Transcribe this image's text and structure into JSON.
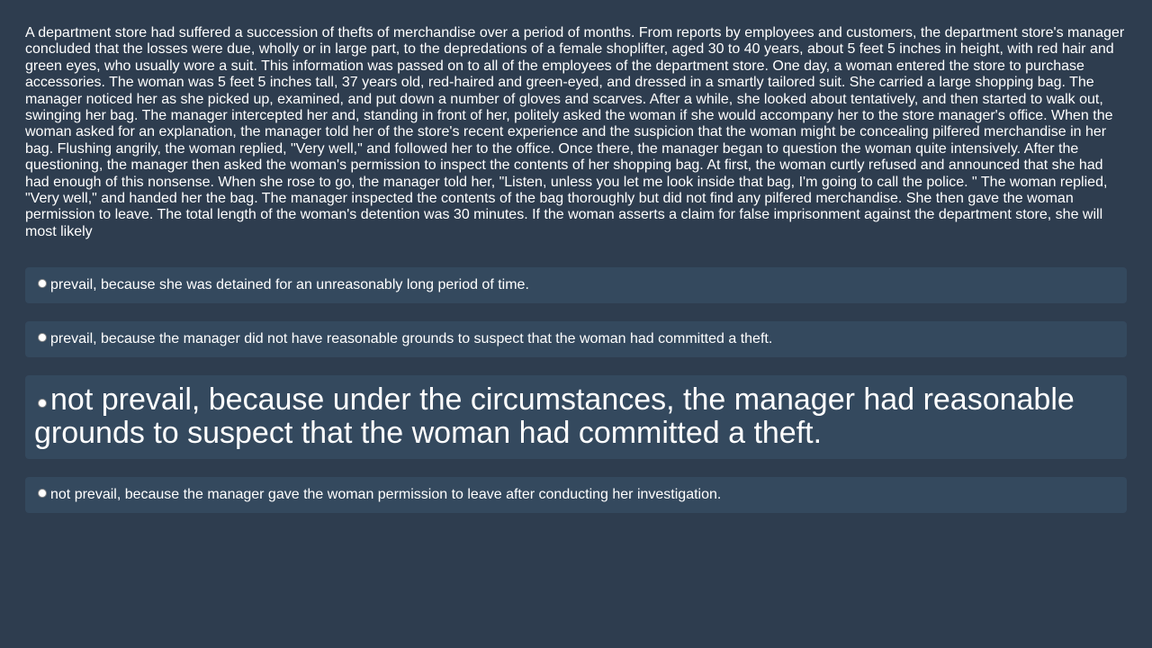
{
  "question": "A department store had suffered a succession of thefts of merchandise over a period of months. From reports by employees and customers, the department store's manager concluded that the losses were due, wholly or in large part, to the depredations of a female shoplifter, aged 30 to 40 years, about 5 feet 5 inches in height, with red hair and green eyes, who usually wore a suit. This information was passed on to all of the employees of the department store. One day, a woman entered the store to purchase accessories. The woman was 5 feet 5 inches tall, 37 years old, red-haired and green-eyed, and dressed in a smartly tailored suit. She carried a large shopping bag. The manager noticed her as she picked up, examined, and put down a number of gloves and scarves. After a while, she looked about tentatively, and then started to walk out, swinging her bag. The manager intercepted her and, standing in front of her, politely asked the woman if she would accompany her to the store manager's office. When the woman asked for an explanation, the manager told her of the store's recent experience and the suspicion that the woman might be concealing pilfered merchandise in her bag. Flushing angrily, the woman replied, \"Very well,\" and followed her to the office. Once there, the manager began to question the woman quite intensively. After the questioning, the manager then asked the woman's permission to inspect the contents of her shopping bag. At first, the woman curtly refused and announced that she had had enough of this nonsense. When she rose to go, the manager told her, \"Listen, unless you let me look inside that bag, I'm going to call the police. \" The woman replied, \"Very well,\" and handed her the bag. The manager inspected the contents of the bag thoroughly but did not find any pilfered merchandise. She then gave the woman permission to leave. The total length of the woman's detention was 30 minutes. If the woman asserts a claim for false imprisonment against the department store, she will most likely",
  "options": [
    "prevail, because she was detained for an unreasonably long period of time.",
    "prevail, because the manager did not have reasonable grounds to suspect that the woman had committed a theft.",
    "not prevail, because under the circumstances, the manager had reasonable grounds to suspect that the woman had committed a theft.",
    "not prevail, because the manager gave the woman permission to leave after conducting her investigation."
  ],
  "colors": {
    "background": "#2e3d4f",
    "option_background": "#34495e",
    "text": "#ffffff"
  }
}
